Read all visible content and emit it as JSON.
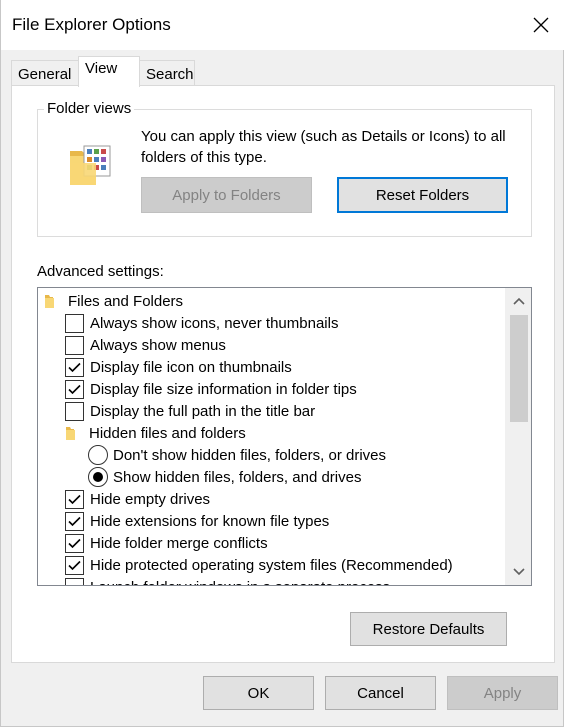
{
  "window": {
    "title": "File Explorer Options"
  },
  "tabs": [
    {
      "label": "General"
    },
    {
      "label": "View"
    },
    {
      "label": "Search"
    }
  ],
  "folder_views": {
    "group_label": "Folder views",
    "description": "You can apply this view (such as Details or Icons) to all folders of this type.",
    "apply_button": "Apply to Folders",
    "reset_button": "Reset Folders"
  },
  "advanced": {
    "label": "Advanced settings:",
    "items": [
      {
        "type": "folder",
        "label": "Files and Folders",
        "level": 0
      },
      {
        "type": "checkbox",
        "label": "Always show icons, never thumbnails",
        "checked": false,
        "level": 1
      },
      {
        "type": "checkbox",
        "label": "Always show menus",
        "checked": false,
        "level": 1
      },
      {
        "type": "checkbox",
        "label": "Display file icon on thumbnails",
        "checked": true,
        "level": 1
      },
      {
        "type": "checkbox",
        "label": "Display file size information in folder tips",
        "checked": true,
        "level": 1
      },
      {
        "type": "checkbox",
        "label": "Display the full path in the title bar",
        "checked": false,
        "level": 1
      },
      {
        "type": "folder",
        "label": "Hidden files and folders",
        "level": 1
      },
      {
        "type": "radio",
        "label": "Don't show hidden files, folders, or drives",
        "checked": false,
        "level": 2
      },
      {
        "type": "radio",
        "label": "Show hidden files, folders, and drives",
        "checked": true,
        "level": 2
      },
      {
        "type": "checkbox",
        "label": "Hide empty drives",
        "checked": true,
        "level": 1
      },
      {
        "type": "checkbox",
        "label": "Hide extensions for known file types",
        "checked": true,
        "level": 1
      },
      {
        "type": "checkbox",
        "label": "Hide folder merge conflicts",
        "checked": true,
        "level": 1
      },
      {
        "type": "checkbox",
        "label": "Hide protected operating system files (Recommended)",
        "checked": true,
        "level": 1
      },
      {
        "type": "checkbox",
        "label": "Launch folder windows in a separate process",
        "checked": false,
        "level": 1
      }
    ],
    "restore_button": "Restore Defaults"
  },
  "footer": {
    "ok": "OK",
    "cancel": "Cancel",
    "apply": "Apply"
  },
  "colors": {
    "focus_border": "#0078d7",
    "folder_yellow": "#f8d775"
  }
}
